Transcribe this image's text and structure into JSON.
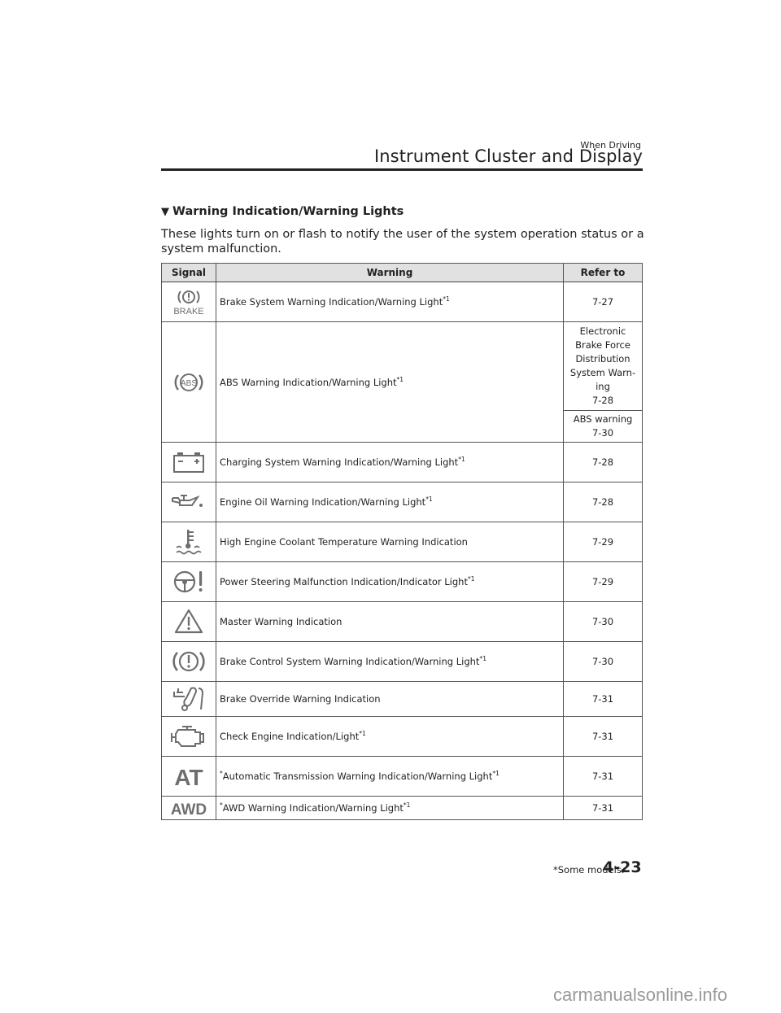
{
  "header": {
    "section": "When Driving",
    "title": "Instrument Cluster and Display"
  },
  "section": {
    "marker": "▼",
    "heading": "Warning Indication/Warning Lights",
    "intro": "These lights turn on or flash to notify the user of the system operation status or a system malfunction."
  },
  "table": {
    "columns": [
      "Signal",
      "Warning",
      "Refer to"
    ],
    "rows": [
      {
        "icon": "brake-warning-icon",
        "prefix": "",
        "warning": "Brake System Warning Indication/Warning Light",
        "note": "*1",
        "refer": [
          "7-27"
        ]
      },
      {
        "icon": "abs-warning-icon",
        "prefix": "",
        "warning": "ABS Warning Indication/Warning Light",
        "note": "*1",
        "refer": [
          "Electronic Brake Force Distribution System Warn-ing 7-28",
          "ABS warning 7-30"
        ]
      },
      {
        "icon": "battery-icon",
        "prefix": "",
        "warning": "Charging System Warning Indication/Warning Light",
        "note": "*1",
        "refer": [
          "7-28"
        ]
      },
      {
        "icon": "oil-can-icon",
        "prefix": "",
        "warning": "Engine Oil Warning Indication/Warning Light",
        "note": "*1",
        "refer": [
          "7-28"
        ]
      },
      {
        "icon": "coolant-temperature-icon",
        "prefix": "",
        "warning": "High Engine Coolant Temperature Warning Indication",
        "note": "",
        "refer": [
          "7-29"
        ]
      },
      {
        "icon": "steering-wheel-warning-icon",
        "prefix": "",
        "warning": "Power Steering Malfunction Indication/Indicator Light",
        "note": "*1",
        "refer": [
          "7-29"
        ]
      },
      {
        "icon": "master-warning-triangle-icon",
        "prefix": "",
        "warning": "Master Warning Indication",
        "note": "",
        "refer": [
          "7-30"
        ]
      },
      {
        "icon": "brake-control-warning-icon",
        "prefix": "",
        "warning": "Brake Control System Warning Indication/Warning Light",
        "note": "*1",
        "refer": [
          "7-30"
        ]
      },
      {
        "icon": "brake-override-icon",
        "prefix": "",
        "warning": "Brake Override Warning Indication",
        "note": "",
        "refer": [
          "7-31"
        ]
      },
      {
        "icon": "check-engine-icon",
        "prefix": "",
        "warning": "Check Engine Indication/Light",
        "note": "*1",
        "refer": [
          "7-31"
        ]
      },
      {
        "icon": "at-icon",
        "prefix": "*",
        "warning": "Automatic Transmission Warning Indication/Warning Light",
        "note": "*1",
        "refer": [
          "7-31"
        ]
      },
      {
        "icon": "awd-icon",
        "prefix": "*",
        "warning": "AWD Warning Indication/Warning Light",
        "note": "*1",
        "refer": [
          "7-31"
        ]
      }
    ],
    "abs_refer_lines": [
      "Electronic",
      "Brake Force",
      "Distribution",
      "System Warn-",
      "ing",
      "7-28"
    ],
    "abs_refer_2_lines": [
      "ABS warning",
      "7-30"
    ],
    "icon_text": {
      "brake": "BRAKE",
      "abs": "ABS",
      "at": "AT",
      "awd": "AWD"
    }
  },
  "footer": {
    "note": "*Some models.",
    "page": "4-23"
  },
  "watermark": "carmanualsonline.info",
  "colors": {
    "icon_gray": "#6e6e6e",
    "header_bg": "#e1e1e1",
    "text": "#222222"
  }
}
